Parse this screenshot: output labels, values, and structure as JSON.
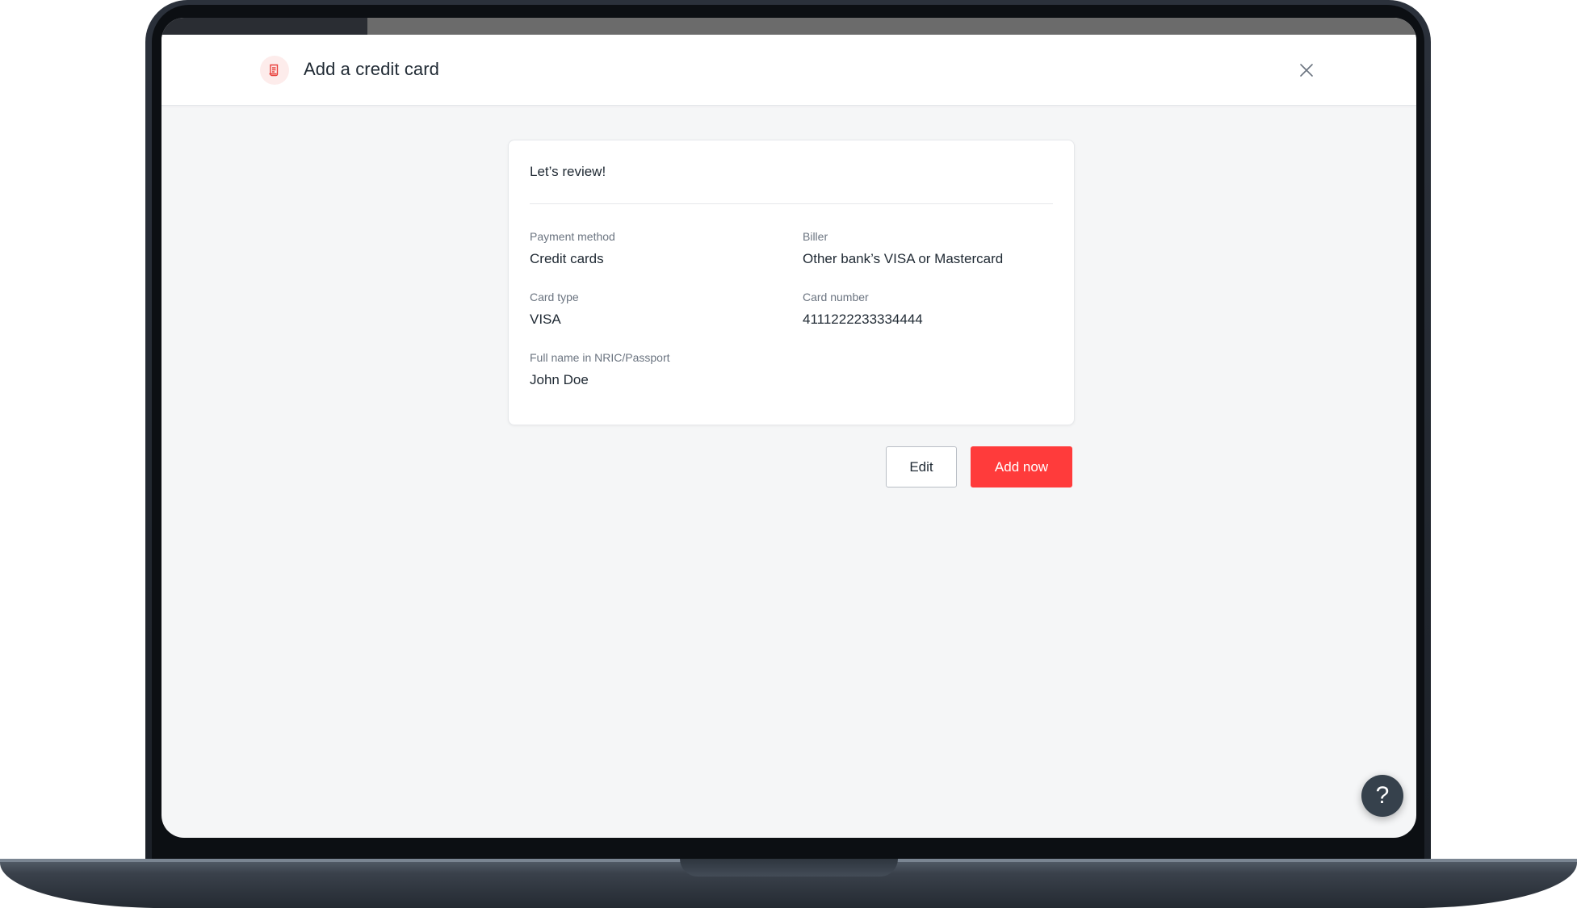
{
  "header": {
    "title": "Add a credit card",
    "icon": "receipt-icon",
    "close_icon": "close-icon"
  },
  "review": {
    "title": "Let’s review!",
    "fields": [
      {
        "label": "Payment method",
        "value": "Credit cards"
      },
      {
        "label": "Biller",
        "value": "Other bank’s VISA or Mastercard"
      },
      {
        "label": "Card type",
        "value": "VISA"
      },
      {
        "label": "Card number",
        "value": "4111222233334444"
      },
      {
        "label": "Full name in NRIC/Passport",
        "value": "John Doe"
      }
    ]
  },
  "actions": {
    "edit_label": "Edit",
    "add_label": "Add now"
  },
  "help": {
    "label": "?",
    "icon": "help-icon"
  },
  "colors": {
    "accent": "#ff3b3b",
    "background": "#f5f6f7",
    "text": "#1f2933"
  }
}
